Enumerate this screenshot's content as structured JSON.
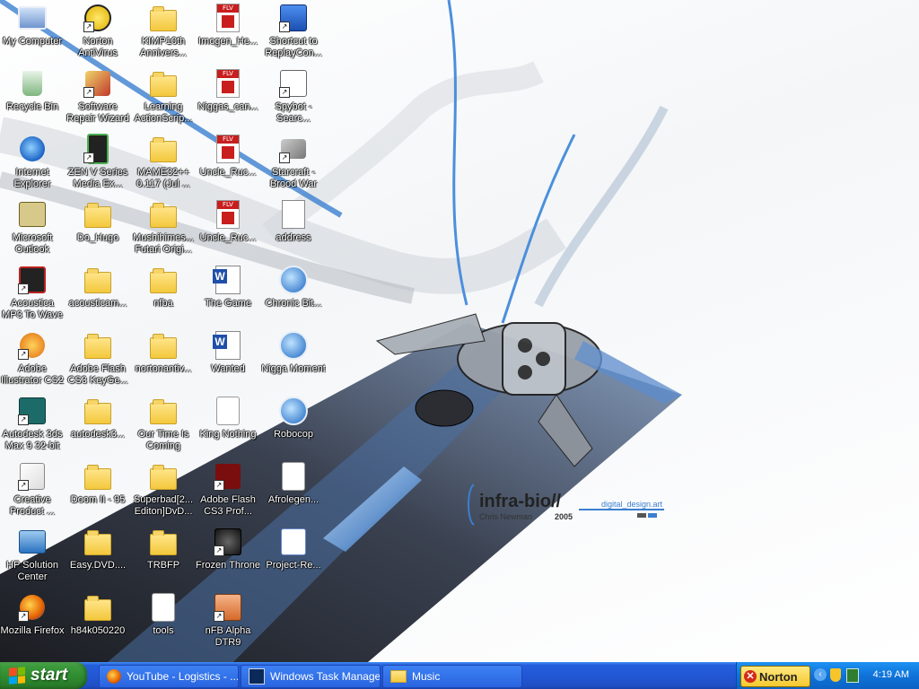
{
  "desktop": {
    "wallpaper": {
      "brand": "infra-bio//",
      "author": "Chris Newman",
      "year": "2005",
      "site": "digital_design.art"
    },
    "icons": [
      {
        "label": "My Computer",
        "type": "computer",
        "col": 0,
        "row": 0,
        "shortcut": false
      },
      {
        "label": "Recycle Bin",
        "type": "recycle",
        "col": 0,
        "row": 1,
        "shortcut": false
      },
      {
        "label": "Internet Explorer",
        "type": "ie",
        "col": 0,
        "row": 2,
        "shortcut": false
      },
      {
        "label": "Microsoft Outlook",
        "type": "outlook",
        "col": 0,
        "row": 3,
        "shortcut": false
      },
      {
        "label": "Acoustica MP3 To Wave C...",
        "type": "app-red",
        "col": 0,
        "row": 4,
        "shortcut": true
      },
      {
        "label": "Adobe Illustrator CS2",
        "type": "app-orange",
        "col": 0,
        "row": 5,
        "shortcut": true
      },
      {
        "label": "Autodesk 3ds Max 9 32-bit",
        "type": "app-teal",
        "col": 0,
        "row": 6,
        "shortcut": true
      },
      {
        "label": "Creative Product ...",
        "type": "app-paper",
        "col": 0,
        "row": 7,
        "shortcut": true
      },
      {
        "label": "HP Solution Center",
        "type": "app-hp",
        "col": 0,
        "row": 8,
        "shortcut": false
      },
      {
        "label": "Mozilla Firefox",
        "type": "firefox",
        "col": 0,
        "row": 9,
        "shortcut": true
      },
      {
        "label": "Norton AntiVirus",
        "type": "norton",
        "col": 1,
        "row": 0,
        "shortcut": true
      },
      {
        "label": "Software Repair Wizard",
        "type": "app-wizard",
        "col": 1,
        "row": 1,
        "shortcut": true
      },
      {
        "label": "ZEN V Series Media Ex...",
        "type": "app-zen",
        "col": 1,
        "row": 2,
        "shortcut": true
      },
      {
        "label": "Do_Hugo",
        "type": "folder",
        "col": 1,
        "row": 3,
        "shortcut": false
      },
      {
        "label": "acousticam...",
        "type": "folder",
        "col": 1,
        "row": 4,
        "shortcut": false
      },
      {
        "label": "Adobe Flash CS3 KeyGe...",
        "type": "folder",
        "col": 1,
        "row": 5,
        "shortcut": false
      },
      {
        "label": "autodesk3...",
        "type": "folder",
        "col": 1,
        "row": 6,
        "shortcut": false
      },
      {
        "label": "Doom II - 95",
        "type": "folder",
        "col": 1,
        "row": 7,
        "shortcut": false
      },
      {
        "label": "Easy.DVD....",
        "type": "folder",
        "col": 1,
        "row": 8,
        "shortcut": false
      },
      {
        "label": "h84k050220",
        "type": "folder",
        "col": 1,
        "row": 9,
        "shortcut": false
      },
      {
        "label": "KIMP10th Annivers...",
        "type": "folder",
        "col": 2,
        "row": 0,
        "shortcut": false
      },
      {
        "label": "Learning ActionScrip...",
        "type": "folder",
        "col": 2,
        "row": 1,
        "shortcut": false
      },
      {
        "label": "MAME32++ 0.117 (Jul ...",
        "type": "folder",
        "col": 2,
        "row": 2,
        "shortcut": false
      },
      {
        "label": "Mushihimes... Futari Origi...",
        "type": "folder",
        "col": 2,
        "row": 3,
        "shortcut": false
      },
      {
        "label": "nfba",
        "type": "folder",
        "col": 2,
        "row": 4,
        "shortcut": false
      },
      {
        "label": "nortonantiv...",
        "type": "folder",
        "col": 2,
        "row": 5,
        "shortcut": false
      },
      {
        "label": "Our Time Is Coming",
        "type": "folder",
        "col": 2,
        "row": 6,
        "shortcut": false
      },
      {
        "label": "Superbad[2... Editon]DvD...",
        "type": "folder",
        "col": 2,
        "row": 7,
        "shortcut": false
      },
      {
        "label": "TRBFP",
        "type": "folder",
        "col": 2,
        "row": 8,
        "shortcut": false
      },
      {
        "label": "tools",
        "type": "fla",
        "col": 2,
        "row": 9,
        "shortcut": false
      },
      {
        "label": "Imogen_He...",
        "type": "flv",
        "col": 3,
        "row": 0,
        "shortcut": false
      },
      {
        "label": "Niggas_can...",
        "type": "flv",
        "col": 3,
        "row": 1,
        "shortcut": false
      },
      {
        "label": "Uncle_Ruc...",
        "type": "flv",
        "col": 3,
        "row": 2,
        "shortcut": false
      },
      {
        "label": "Uncle_Ruc...",
        "type": "flv",
        "col": 3,
        "row": 3,
        "shortcut": false
      },
      {
        "label": "The Game",
        "type": "word",
        "col": 3,
        "row": 4,
        "shortcut": false
      },
      {
        "label": "Wanted",
        "type": "word",
        "col": 3,
        "row": 5,
        "shortcut": false
      },
      {
        "label": "King Nothing",
        "type": "mp3",
        "col": 3,
        "row": 6,
        "shortcut": false
      },
      {
        "label": "Adobe Flash CS3 Prof...",
        "type": "flash",
        "col": 3,
        "row": 7,
        "shortcut": true
      },
      {
        "label": "Frozen Throne",
        "type": "app-dark",
        "col": 3,
        "row": 8,
        "shortcut": true
      },
      {
        "label": "nFB Alpha DTR9",
        "type": "app-nfb",
        "col": 3,
        "row": 9,
        "shortcut": true
      },
      {
        "label": "Shortcut to ReplayCon...",
        "type": "app-blue",
        "col": 4,
        "row": 0,
        "shortcut": true
      },
      {
        "label": "Spybot - Searc...",
        "type": "app-spybot",
        "col": 4,
        "row": 1,
        "shortcut": true
      },
      {
        "label": "Starcraft - Brood War",
        "type": "app-starcraft",
        "col": 4,
        "row": 2,
        "shortcut": true
      },
      {
        "label": "address",
        "type": "doc",
        "col": 4,
        "row": 3,
        "shortcut": false
      },
      {
        "label": "Chronic Bit...",
        "type": "media",
        "col": 4,
        "row": 4,
        "shortcut": false
      },
      {
        "label": "Nigga Moment",
        "type": "media",
        "col": 4,
        "row": 5,
        "shortcut": false
      },
      {
        "label": "Robocop",
        "type": "media",
        "col": 4,
        "row": 6,
        "shortcut": false
      },
      {
        "label": "Afrolegen...",
        "type": "wmv",
        "col": 4,
        "row": 7,
        "shortcut": false
      },
      {
        "label": "Project-Re...",
        "type": "app-project",
        "col": 4,
        "row": 8,
        "shortcut": false
      }
    ]
  },
  "taskbar": {
    "start_label": "start",
    "tasks": [
      {
        "label": "YouTube - Logistics - ...",
        "icon": "firefox-icon"
      },
      {
        "label": "Windows Task Manager",
        "icon": "task-manager-icon"
      },
      {
        "label": "Music",
        "icon": "folder-icon"
      }
    ],
    "tray": {
      "norton_label": "Norton",
      "clock": "4:19 AM"
    }
  }
}
